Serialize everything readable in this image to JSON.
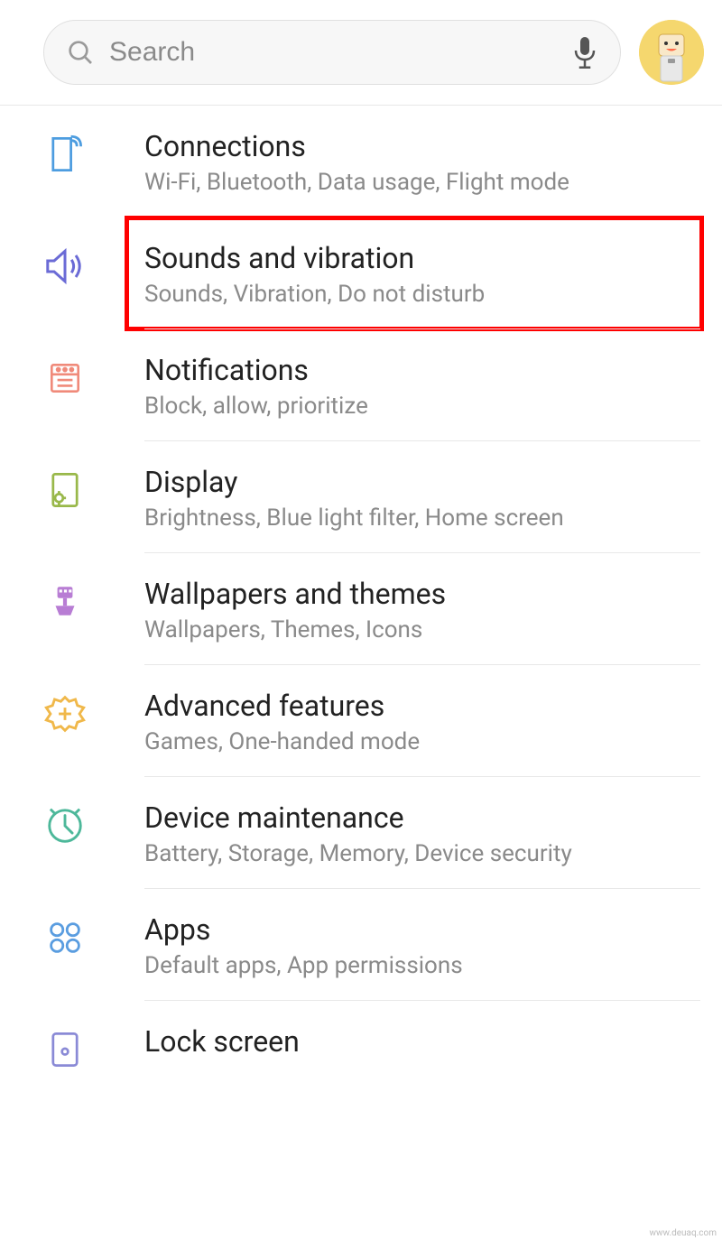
{
  "search": {
    "placeholder": "Search"
  },
  "items": [
    {
      "title": "Connections",
      "sub": "Wi-Fi, Bluetooth, Data usage, Flight mode"
    },
    {
      "title": "Sounds and vibration",
      "sub": "Sounds, Vibration, Do not disturb"
    },
    {
      "title": "Notifications",
      "sub": "Block, allow, prioritize"
    },
    {
      "title": "Display",
      "sub": "Brightness, Blue light filter, Home screen"
    },
    {
      "title": "Wallpapers and themes",
      "sub": "Wallpapers, Themes, Icons"
    },
    {
      "title": "Advanced features",
      "sub": "Games, One-handed mode"
    },
    {
      "title": "Device maintenance",
      "sub": "Battery, Storage, Memory, Device security"
    },
    {
      "title": "Apps",
      "sub": "Default apps, App permissions"
    },
    {
      "title": "Lock screen",
      "sub": ""
    }
  ],
  "watermark": "www.deuaq.com"
}
